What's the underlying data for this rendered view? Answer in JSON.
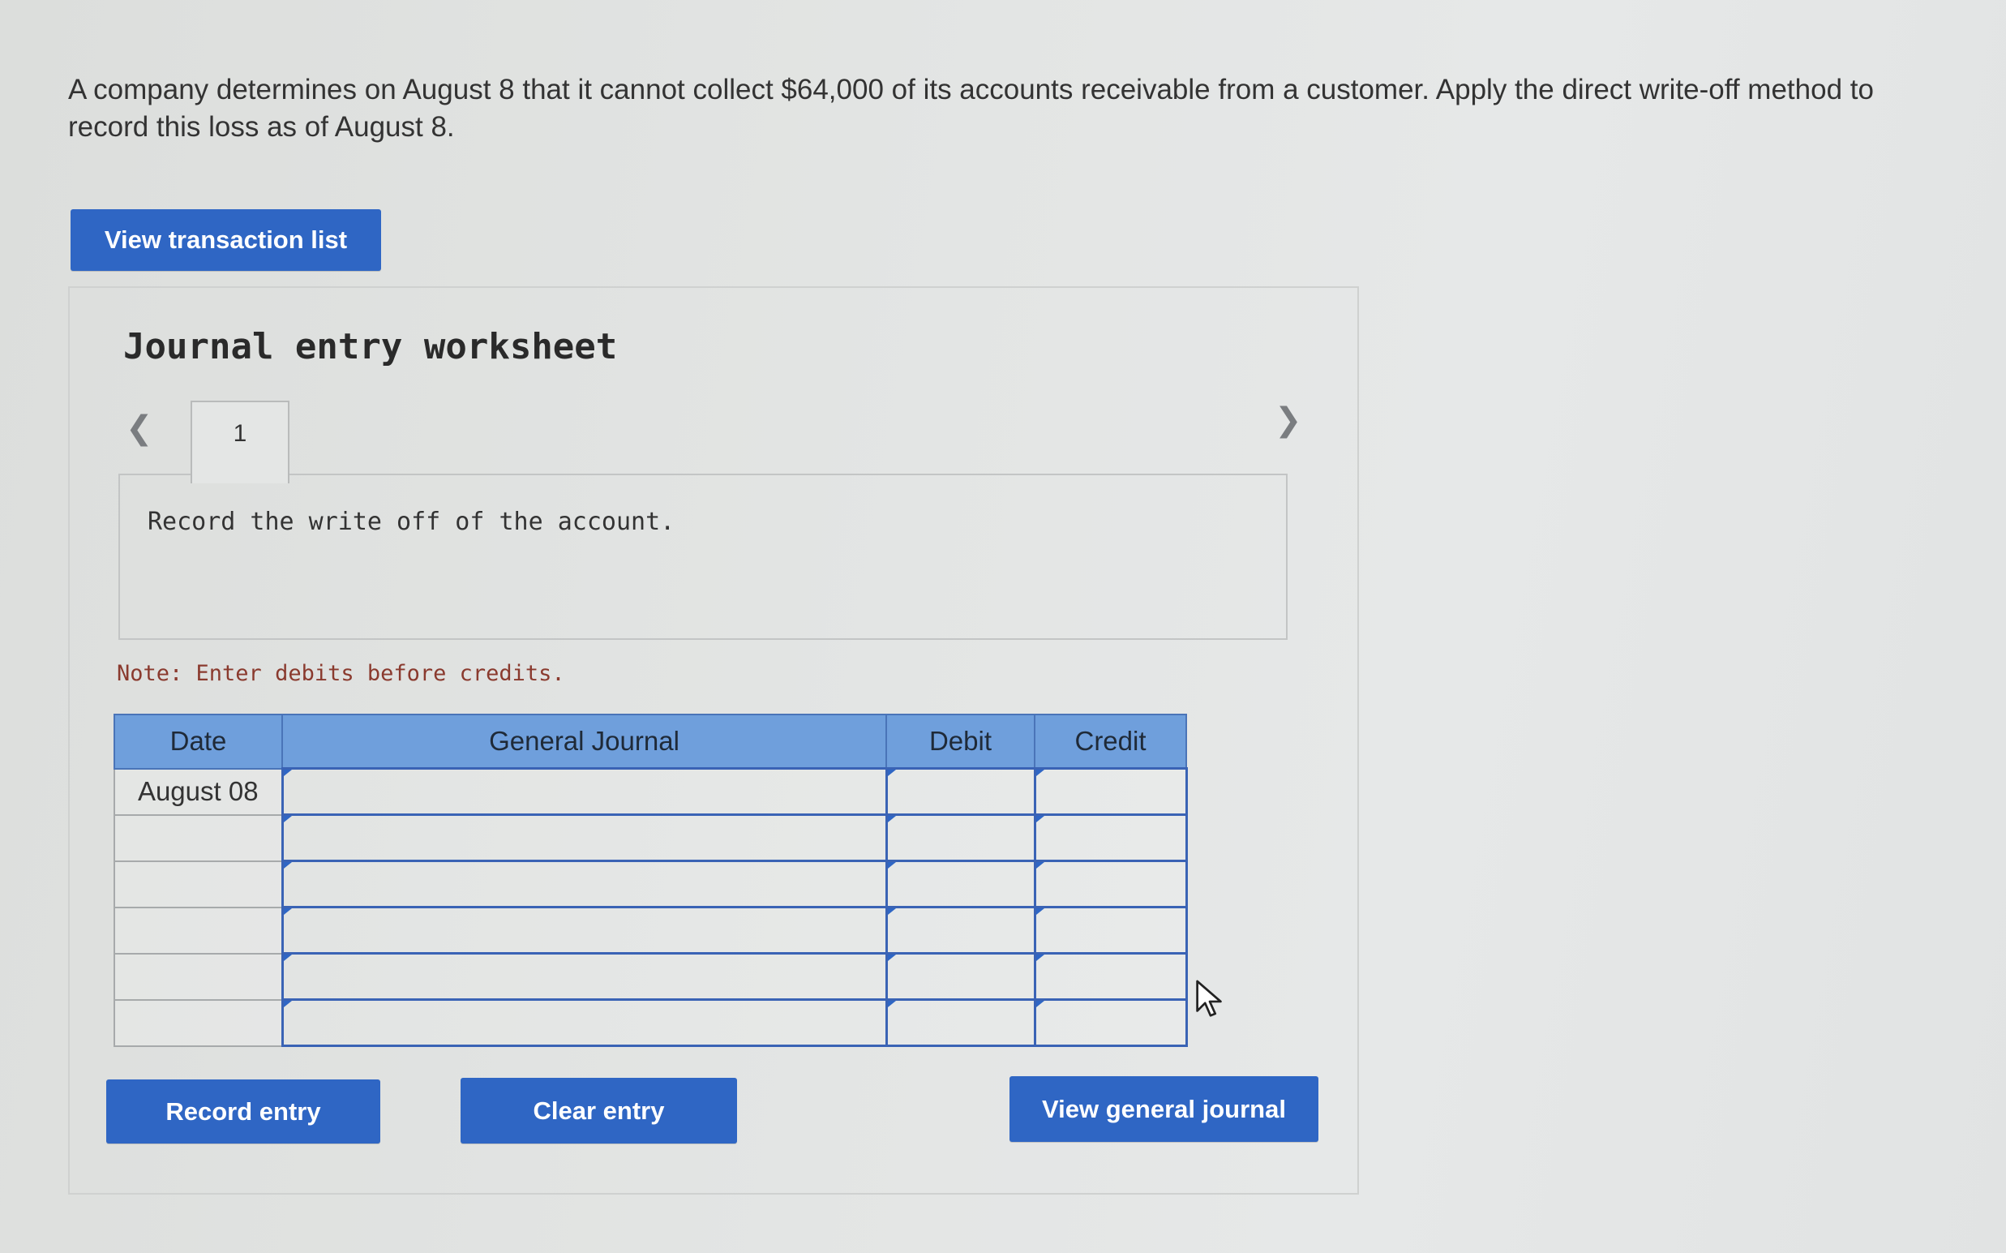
{
  "question": {
    "text": "A company determines on August 8 that it cannot collect $64,000 of its accounts receivable from a customer. Apply the direct write-off method to record this loss as of August 8."
  },
  "buttons": {
    "view_transaction_list": "View transaction list",
    "record_entry": "Record entry",
    "clear_entry": "Clear entry",
    "view_general_journal": "View general journal"
  },
  "worksheet": {
    "title": "Journal entry worksheet",
    "tab_label": "1",
    "instruction": "Record the write off of the account.",
    "note": "Note: Enter debits before credits."
  },
  "journal_table": {
    "headers": {
      "date": "Date",
      "general_journal": "General Journal",
      "debit": "Debit",
      "credit": "Credit"
    },
    "rows": [
      {
        "date": "August 08",
        "account": "",
        "debit": "",
        "credit": ""
      },
      {
        "date": "",
        "account": "",
        "debit": "",
        "credit": ""
      },
      {
        "date": "",
        "account": "",
        "debit": "",
        "credit": ""
      },
      {
        "date": "",
        "account": "",
        "debit": "",
        "credit": ""
      },
      {
        "date": "",
        "account": "",
        "debit": "",
        "credit": ""
      },
      {
        "date": "",
        "account": "",
        "debit": "",
        "credit": ""
      }
    ]
  },
  "icons": {
    "prev": "chevron-left-icon",
    "next": "chevron-right-icon",
    "cursor": "mouse-pointer-icon"
  },
  "colors": {
    "button_blue": "#2f66c4",
    "header_blue": "#6f9fdc",
    "input_border_blue": "#3a63b5",
    "note_text": "#8a3a2e"
  }
}
